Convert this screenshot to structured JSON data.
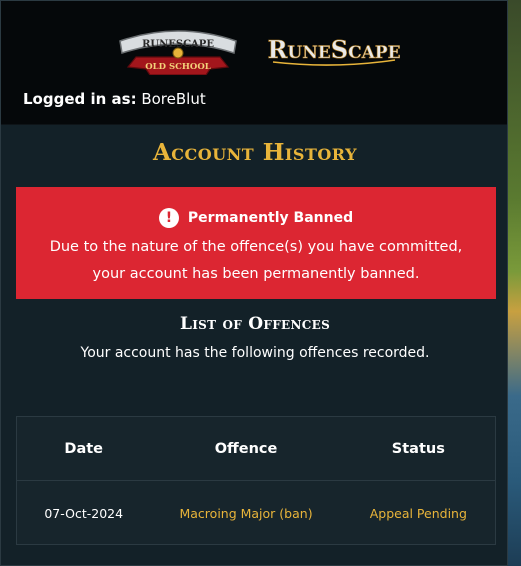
{
  "header": {
    "logos": {
      "osrs_top": "RUNESCAPE",
      "osrs_banner": "OLD SCHOOL",
      "rs": "RuneScape"
    },
    "logged_in_label": "Logged in as:",
    "username": "BoreBlut"
  },
  "page": {
    "title": "Account History"
  },
  "alert": {
    "icon": "exclamation-circle-icon",
    "title": "Permanently Banned",
    "message": "Due to the nature of the offence(s) you have committed, your account has been permanently banned.",
    "color": "#dc2632"
  },
  "offences": {
    "title": "List of Offences",
    "description": "Your account has the following offences recorded.",
    "columns": [
      "Date",
      "Offence",
      "Status"
    ],
    "rows": [
      {
        "date": "07-Oct-2024",
        "offence": "Macroing Major (ban)",
        "status": "Appeal Pending"
      }
    ]
  },
  "colors": {
    "accent_gold": "#e8b43a",
    "panel_bg": "#132128",
    "header_bg": "#05080a"
  }
}
